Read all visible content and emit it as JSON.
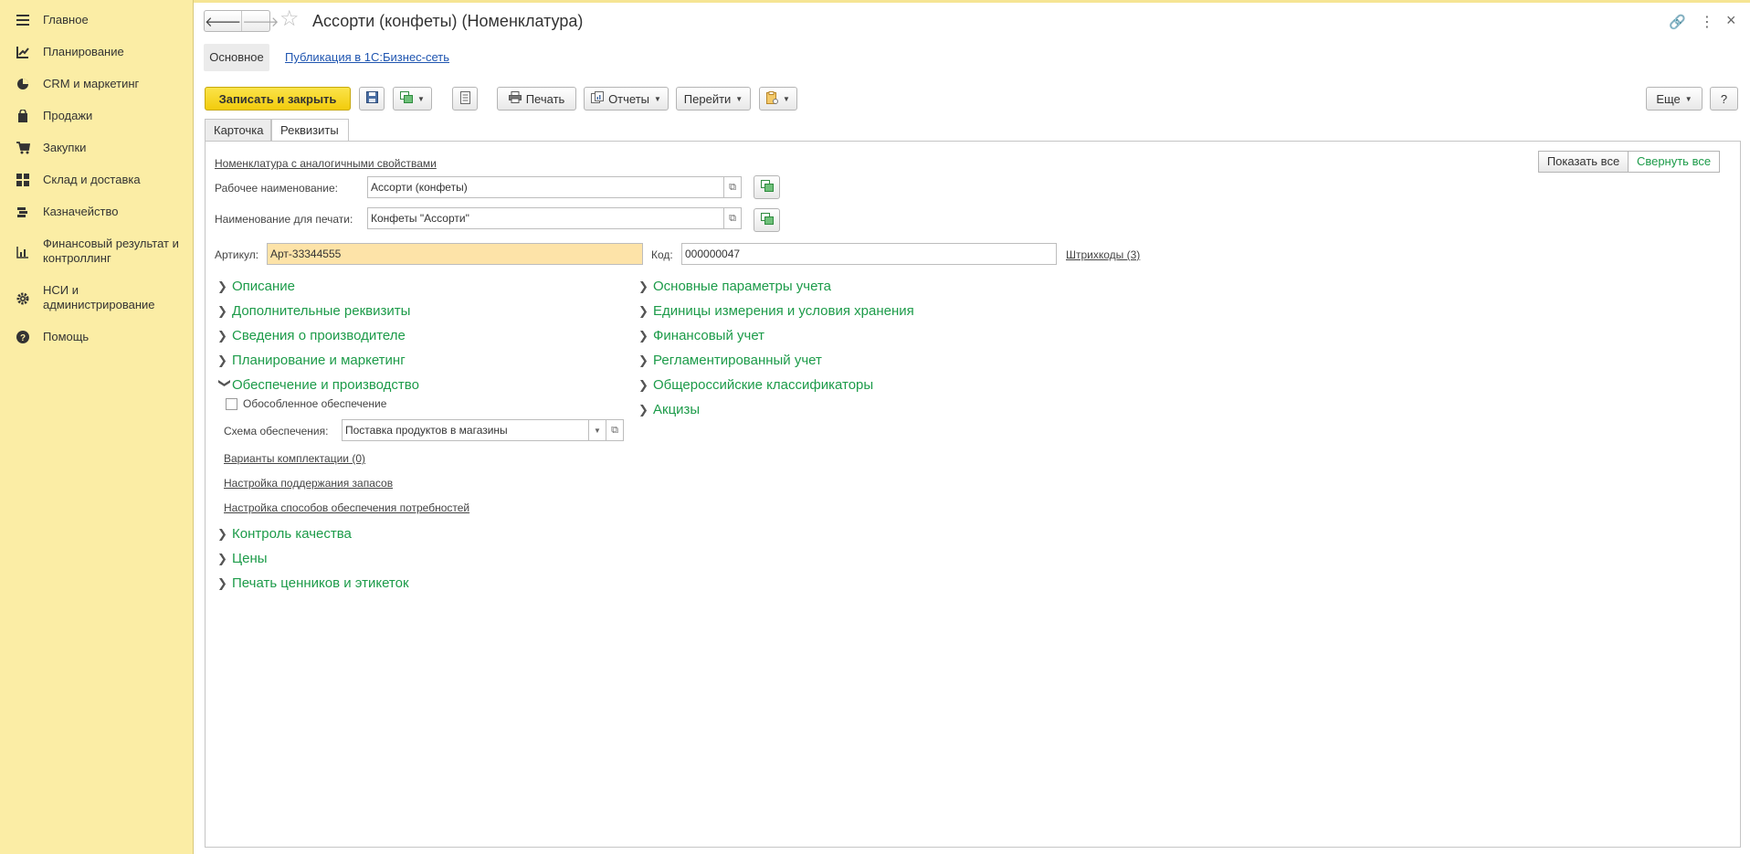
{
  "sidebar": {
    "items": [
      {
        "label": "Главное",
        "icon": "menu-icon"
      },
      {
        "label": "Планирование",
        "icon": "chart-up-icon"
      },
      {
        "label": "CRM и маркетинг",
        "icon": "pie-chart-icon"
      },
      {
        "label": "Продажи",
        "icon": "shopping-bag-icon"
      },
      {
        "label": "Закупки",
        "icon": "cart-icon"
      },
      {
        "label": "Склад и доставка",
        "icon": "grid-icon"
      },
      {
        "label": "Казначейство",
        "icon": "money-icon"
      },
      {
        "label": "Финансовый результат и контроллинг",
        "icon": "bar-chart-icon"
      },
      {
        "label": "НСИ и администрирование",
        "icon": "gear-icon"
      },
      {
        "label": "Помощь",
        "icon": "question-icon"
      }
    ]
  },
  "header": {
    "title": "Ассорти (конфеты) (Номенклатура)",
    "back": "🡐",
    "forward": "🡒",
    "star": "☆",
    "link_icon": "🔗",
    "more_icon": "⋮",
    "close_icon": "×"
  },
  "subtabs": {
    "main": "Основное",
    "publication": "Публикация в 1С:Бизнес-сеть"
  },
  "toolbar": {
    "save_close": "Записать и закрыть",
    "print": "Печать",
    "reports": "Отчеты",
    "goto": "Перейти",
    "more": "Еще",
    "help": "?"
  },
  "tabs": {
    "card": "Карточка",
    "requisites": "Реквизиты"
  },
  "form": {
    "similar_link": "Номенклатура с аналогичными свойствами",
    "show_all": "Показать все",
    "collapse_all": "Свернуть все",
    "work_name_label": "Рабочее наименование:",
    "work_name_value": "Ассорти (конфеты)",
    "print_name_label": "Наименование для печати:",
    "print_name_value": "Конфеты \"Ассорти\"",
    "article_label": "Артикул:",
    "article_value": "Арт-33344555",
    "code_label": "Код:",
    "code_value": "000000047",
    "barcodes_link": "Штрихкоды (3)"
  },
  "groups_left": [
    "Описание",
    "Дополнительные реквизиты",
    "Сведения о производителе",
    "Планирование и маркетинг",
    "Обеспечение и производство"
  ],
  "supply": {
    "separate_supply": "Обособленное обеспечение",
    "scheme_label": "Схема обеспечения:",
    "scheme_value": "Поставка продуктов в магазины",
    "kit_link": "Варианты комплектации (0)",
    "stock_link": "Настройка поддержания запасов",
    "methods_link": "Настройка способов обеспечения потребностей"
  },
  "groups_left_bottom": [
    "Контроль качества",
    "Цены",
    "Печать ценников и этикеток"
  ],
  "groups_right": [
    "Основные параметры учета",
    "Единицы измерения и условия хранения",
    "Финансовый учет",
    "Регламентированный учет",
    "Общероссийские классификаторы",
    "Акцизы"
  ],
  "colors": {
    "sidebar_bg": "#fbeda5",
    "primary_button": "#f5d21b",
    "group_green": "#1c9b49",
    "link_blue": "#1f55b0",
    "highlight_field": "#fde3a8"
  }
}
